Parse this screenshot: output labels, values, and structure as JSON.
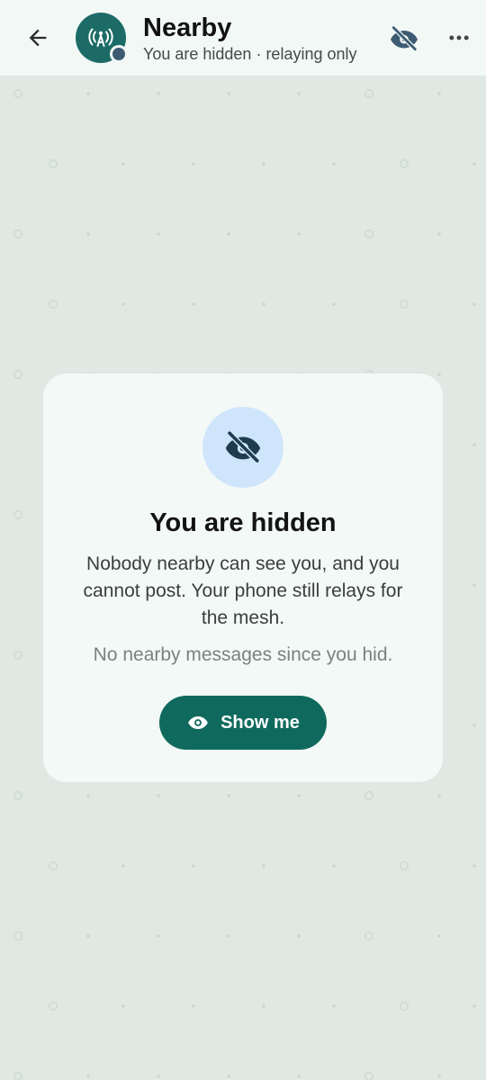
{
  "header": {
    "title": "Nearby",
    "subtitle": "You are hidden · relaying only",
    "back_icon": "arrow-left-icon",
    "avatar_icon": "broadcast-antenna-icon",
    "visibility_icon": "eye-off-icon",
    "menu_icon": "more-horizontal-icon"
  },
  "card": {
    "icon": "eye-off-icon",
    "title": "You are hidden",
    "body": "Nobody nearby can see you, and you cannot post. Your phone still relays for the mesh.",
    "note": "No nearby messages since you hid.",
    "button_label": "Show me",
    "button_icon": "eye-icon"
  },
  "colors": {
    "appbar_bg": "#f2f8f6",
    "page_bg": "#dfe8e3",
    "accent": "#0f6a5d",
    "avatar_bg": "#1c6b66",
    "hidden_icon": "#3d5c73",
    "icon_circle_bg": "#cfe5fb"
  }
}
